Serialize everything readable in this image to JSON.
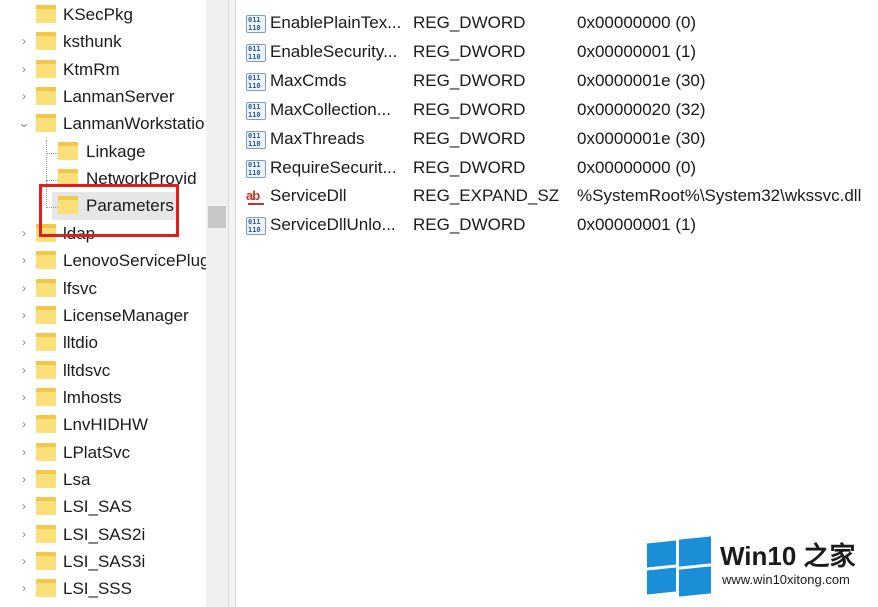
{
  "tree": {
    "items": [
      {
        "label": "KSecPkg",
        "chevron": ""
      },
      {
        "label": "ksthunk",
        "chevron": ">"
      },
      {
        "label": "KtmRm",
        "chevron": ">"
      },
      {
        "label": "LanmanServer",
        "chevron": ">"
      },
      {
        "label": "LanmanWorkstatio",
        "chevron": "v"
      },
      {
        "label": "Linkage",
        "chevron": ""
      },
      {
        "label": "NetworkProvid",
        "chevron": ""
      },
      {
        "label": "Parameters",
        "chevron": ""
      },
      {
        "label": "ldap",
        "chevron": ">"
      },
      {
        "label": "LenovoServicePlug",
        "chevron": ">"
      },
      {
        "label": "lfsvc",
        "chevron": ">"
      },
      {
        "label": "LicenseManager",
        "chevron": ">"
      },
      {
        "label": "lltdio",
        "chevron": ">"
      },
      {
        "label": "lltdsvc",
        "chevron": ">"
      },
      {
        "label": "lmhosts",
        "chevron": ">"
      },
      {
        "label": "LnvHIDHW",
        "chevron": ">"
      },
      {
        "label": "LPlatSvc",
        "chevron": ">"
      },
      {
        "label": "Lsa",
        "chevron": ">"
      },
      {
        "label": "LSI_SAS",
        "chevron": ">"
      },
      {
        "label": "LSI_SAS2i",
        "chevron": ">"
      },
      {
        "label": "LSI_SAS3i",
        "chevron": ">"
      },
      {
        "label": "LSI_SSS",
        "chevron": ">"
      }
    ]
  },
  "values": {
    "rows": [
      {
        "name": "EnablePlainTex...",
        "type": "REG_DWORD",
        "data": "0x00000000 (0)",
        "icon": "binary-value-icon"
      },
      {
        "name": "EnableSecurity...",
        "type": "REG_DWORD",
        "data": "0x00000001 (1)",
        "icon": "binary-value-icon"
      },
      {
        "name": "MaxCmds",
        "type": "REG_DWORD",
        "data": "0x0000001e (30)",
        "icon": "binary-value-icon"
      },
      {
        "name": "MaxCollection...",
        "type": "REG_DWORD",
        "data": "0x00000020 (32)",
        "icon": "binary-value-icon"
      },
      {
        "name": "MaxThreads",
        "type": "REG_DWORD",
        "data": "0x0000001e (30)",
        "icon": "binary-value-icon"
      },
      {
        "name": "RequireSecurit...",
        "type": "REG_DWORD",
        "data": "0x00000000 (0)",
        "icon": "binary-value-icon"
      },
      {
        "name": "ServiceDll",
        "type": "REG_EXPAND_SZ",
        "data": "%SystemRoot%\\System32\\wkssvc.dll",
        "icon": "string-value-icon"
      },
      {
        "name": "ServiceDllUnlo...",
        "type": "REG_DWORD",
        "data": "0x00000001 (1)",
        "icon": "binary-value-icon"
      }
    ]
  },
  "icons": {
    "binary_row1": "011",
    "binary_row2": "110",
    "string_glyph": "ab"
  },
  "watermark": {
    "title": "Win10 之家",
    "url": "www.win10xitong.com"
  },
  "colors": {
    "highlight_box": "#e02020",
    "folder": "#f2c74a",
    "logo": "#1a8fd8"
  }
}
